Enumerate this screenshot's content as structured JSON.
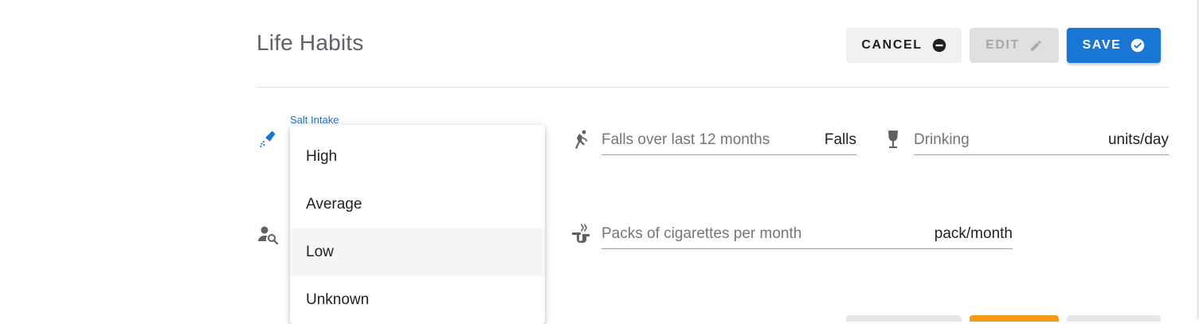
{
  "header": {
    "title": "Life Habits"
  },
  "toolbar": {
    "cancel_label": "CANCEL",
    "edit_label": "EDIT",
    "save_label": "SAVE"
  },
  "salt_intake": {
    "label": "Salt Intake",
    "options": [
      "High",
      "Average",
      "Low",
      "Unknown"
    ],
    "highlighted": "Low"
  },
  "fields": {
    "falls": {
      "placeholder": "Falls over last 12 months",
      "unit": "Falls"
    },
    "drinking": {
      "placeholder": "Drinking",
      "unit": "units/day"
    },
    "cigarettes": {
      "placeholder": "Packs of cigarettes per month",
      "unit": "pack/month"
    }
  },
  "icons": {
    "salt": "salt-shaker-icon",
    "falls": "falling-person-icon",
    "drinking": "wine-glass-icon",
    "person_search": "person-search-icon",
    "smoking": "pipe-icon",
    "cancel": "minus-circle-icon",
    "edit": "pencil-icon",
    "save": "check-circle-icon"
  },
  "colors": {
    "primary": "#1976d2",
    "accent_orange": "#f39c12",
    "disabled": "#e0e0e0"
  }
}
